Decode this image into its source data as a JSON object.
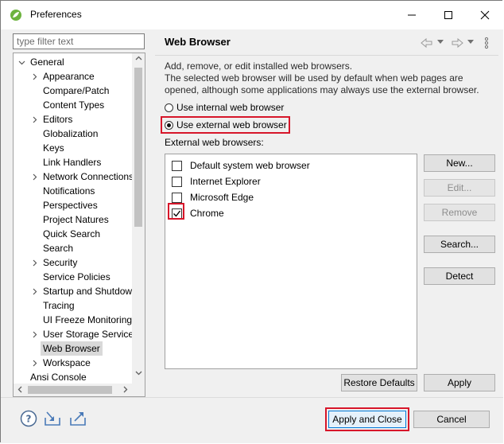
{
  "window": {
    "title": "Preferences"
  },
  "filter": {
    "placeholder": "type filter text"
  },
  "tree": {
    "items": [
      {
        "label": "General",
        "level": 0,
        "expander": "expanded"
      },
      {
        "label": "Appearance",
        "level": 1,
        "expander": "collapsed"
      },
      {
        "label": "Compare/Patch",
        "level": 1,
        "expander": "none"
      },
      {
        "label": "Content Types",
        "level": 1,
        "expander": "none"
      },
      {
        "label": "Editors",
        "level": 1,
        "expander": "collapsed"
      },
      {
        "label": "Globalization",
        "level": 1,
        "expander": "none"
      },
      {
        "label": "Keys",
        "level": 1,
        "expander": "none"
      },
      {
        "label": "Link Handlers",
        "level": 1,
        "expander": "none"
      },
      {
        "label": "Network Connections",
        "level": 1,
        "expander": "collapsed"
      },
      {
        "label": "Notifications",
        "level": 1,
        "expander": "none"
      },
      {
        "label": "Perspectives",
        "level": 1,
        "expander": "none"
      },
      {
        "label": "Project Natures",
        "level": 1,
        "expander": "none"
      },
      {
        "label": "Quick Search",
        "level": 1,
        "expander": "none"
      },
      {
        "label": "Search",
        "level": 1,
        "expander": "none"
      },
      {
        "label": "Security",
        "level": 1,
        "expander": "collapsed"
      },
      {
        "label": "Service Policies",
        "level": 1,
        "expander": "none"
      },
      {
        "label": "Startup and Shutdown",
        "level": 1,
        "expander": "collapsed"
      },
      {
        "label": "Tracing",
        "level": 1,
        "expander": "none"
      },
      {
        "label": "UI Freeze Monitoring",
        "level": 1,
        "expander": "none"
      },
      {
        "label": "User Storage Service",
        "level": 1,
        "expander": "collapsed"
      },
      {
        "label": "Web Browser",
        "level": 1,
        "expander": "none",
        "selected": true
      },
      {
        "label": "Workspace",
        "level": 1,
        "expander": "collapsed"
      },
      {
        "label": "Ansi Console",
        "level": 0,
        "expander": "none"
      }
    ]
  },
  "page": {
    "title": "Web Browser",
    "desc_line1": "Add, remove, or edit installed web browsers.",
    "desc_line2": "The selected web browser will be used by default when web pages are opened, although some applications may always use the external browser.",
    "radio_internal": "Use internal web browser",
    "radio_external": "Use external web browser",
    "selected_mode": "external",
    "external_label": "External web browsers:",
    "browsers": [
      {
        "name": "Default system web browser",
        "checked": false
      },
      {
        "name": "Internet Explorer",
        "checked": false
      },
      {
        "name": "Microsoft Edge",
        "checked": false
      },
      {
        "name": "Chrome",
        "checked": true
      }
    ],
    "buttons": {
      "new": "New...",
      "edit": "Edit...",
      "remove": "Remove",
      "search": "Search...",
      "detect": "Detect",
      "restore": "Restore Defaults",
      "apply": "Apply"
    }
  },
  "footer": {
    "apply_close": "Apply and Close",
    "cancel": "Cancel"
  },
  "colors": {
    "highlight": "#d7162a",
    "selection": "#d9d9d9"
  }
}
